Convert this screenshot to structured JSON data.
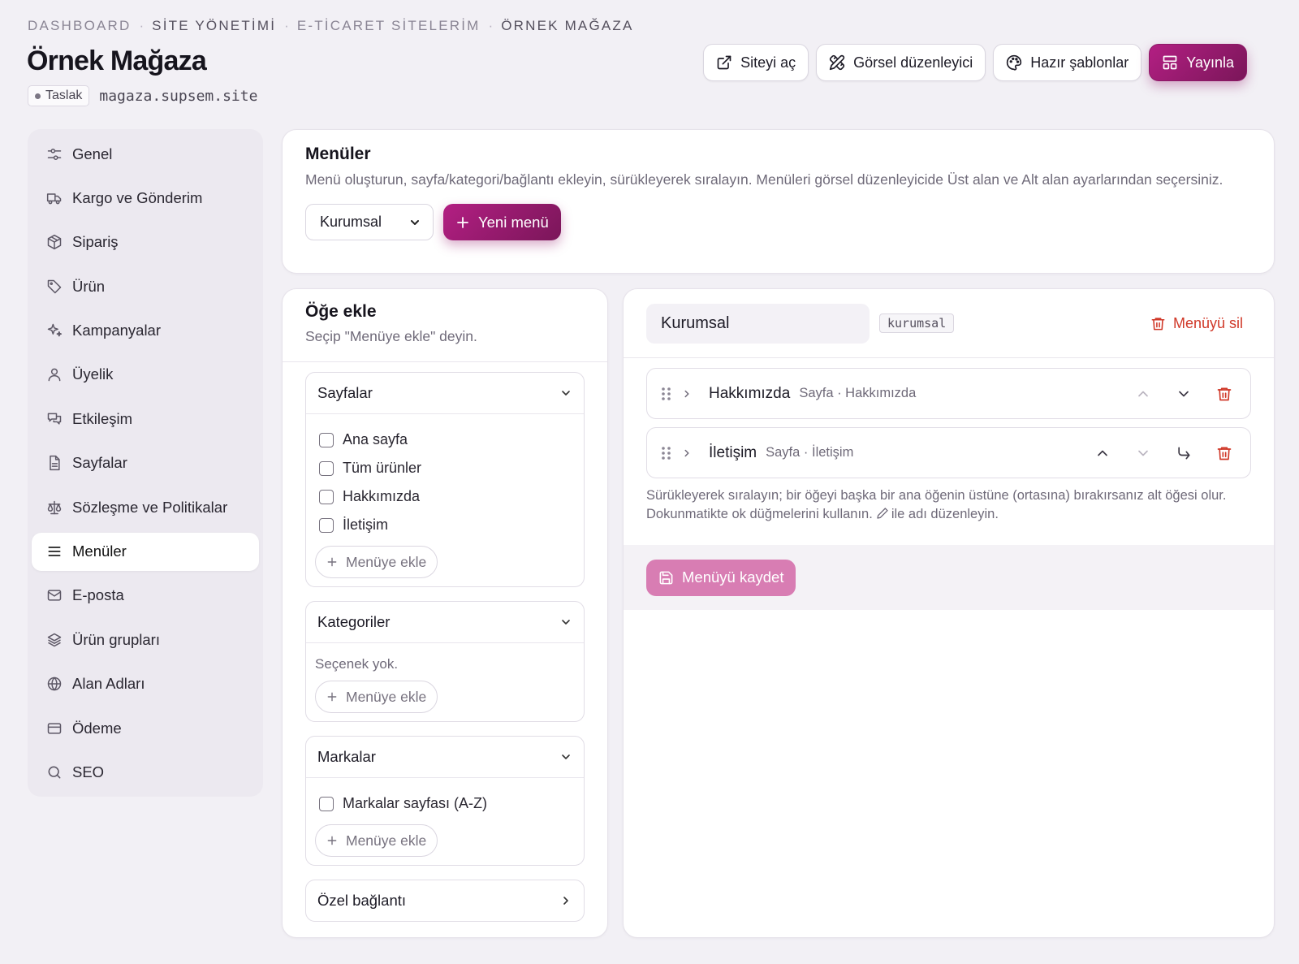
{
  "breadcrumb": [
    "DASHBOARD",
    "SİTE YÖNETİMİ",
    "E-TİCARET SİTELERİM",
    "ÖRNEK MAĞAZA"
  ],
  "page": {
    "title": "Örnek Mağaza",
    "status_badge": "Taslak",
    "domain": "magaza.supsem.site"
  },
  "actions": {
    "open_site": "Siteyi aç",
    "visual_editor": "Görsel düzenleyici",
    "templates": "Hazır şablonlar",
    "publish": "Yayınla"
  },
  "sidebar": {
    "items": [
      {
        "label": "Genel",
        "icon": "sliders-icon"
      },
      {
        "label": "Kargo ve Gönderim",
        "icon": "truck-icon"
      },
      {
        "label": "Sipariş",
        "icon": "package-icon"
      },
      {
        "label": "Ürün",
        "icon": "tag-icon"
      },
      {
        "label": "Kampanyalar",
        "icon": "sparkles-icon"
      },
      {
        "label": "Üyelik",
        "icon": "user-icon"
      },
      {
        "label": "Etkileşim",
        "icon": "chat-icon"
      },
      {
        "label": "Sayfalar",
        "icon": "file-icon"
      },
      {
        "label": "Sözleşme ve Politikalar",
        "icon": "scale-icon"
      },
      {
        "label": "Menüler",
        "icon": "menu-icon",
        "active": true
      },
      {
        "label": "E-posta",
        "icon": "mail-icon"
      },
      {
        "label": "Ürün grupları",
        "icon": "layers-icon"
      },
      {
        "label": "Alan Adları",
        "icon": "globe-icon"
      },
      {
        "label": "Ödeme",
        "icon": "card-icon"
      },
      {
        "label": "SEO",
        "icon": "search-icon"
      }
    ]
  },
  "menus": {
    "title": "Menüler",
    "description": "Menü oluşturun, sayfa/kategori/bağlantı ekleyin, sürükleyerek sıralayın. Menüleri görsel düzenleyicide Üst alan ve Alt alan ayarlarından seçersiniz.",
    "selected_menu": "Kurumsal",
    "new_menu_button": "Yeni menü"
  },
  "add_items": {
    "title": "Öğe ekle",
    "subtitle": "Seçip \"Menüye ekle\" deyin.",
    "add_button": "Menüye ekle",
    "pages": {
      "title": "Sayfalar",
      "options": [
        "Ana sayfa",
        "Tüm ürünler",
        "Hakkımızda",
        "İletişim"
      ]
    },
    "categories": {
      "title": "Kategoriler",
      "empty": "Seçenek yok."
    },
    "brands": {
      "title": "Markalar",
      "options": [
        "Markalar sayfası (A-Z)"
      ]
    },
    "custom_link": {
      "title": "Özel bağlantı"
    }
  },
  "editor": {
    "menu_name": "Kurumsal",
    "slug": "kurumsal",
    "delete_menu": "Menüyü sil",
    "items": [
      {
        "title": "Hakkımızda",
        "subtitle": "Sayfa · Hakkımızda"
      },
      {
        "title": "İletişim",
        "subtitle": "Sayfa · İletişim"
      }
    ],
    "hint_part1": "Sürükleyerek sıralayın; bir öğeyi başka bir ana öğenin üstüne (ortasına) bırakırsanız alt öğesi olur. Dokunmatikte ok düğmelerini kullanın.",
    "hint_part2": "ile adı düzenleyin.",
    "save_button": "Menüyü kaydet"
  },
  "colors": {
    "accent": "#a11d78",
    "danger": "#d03828",
    "save_disabled": "#d87db3"
  }
}
